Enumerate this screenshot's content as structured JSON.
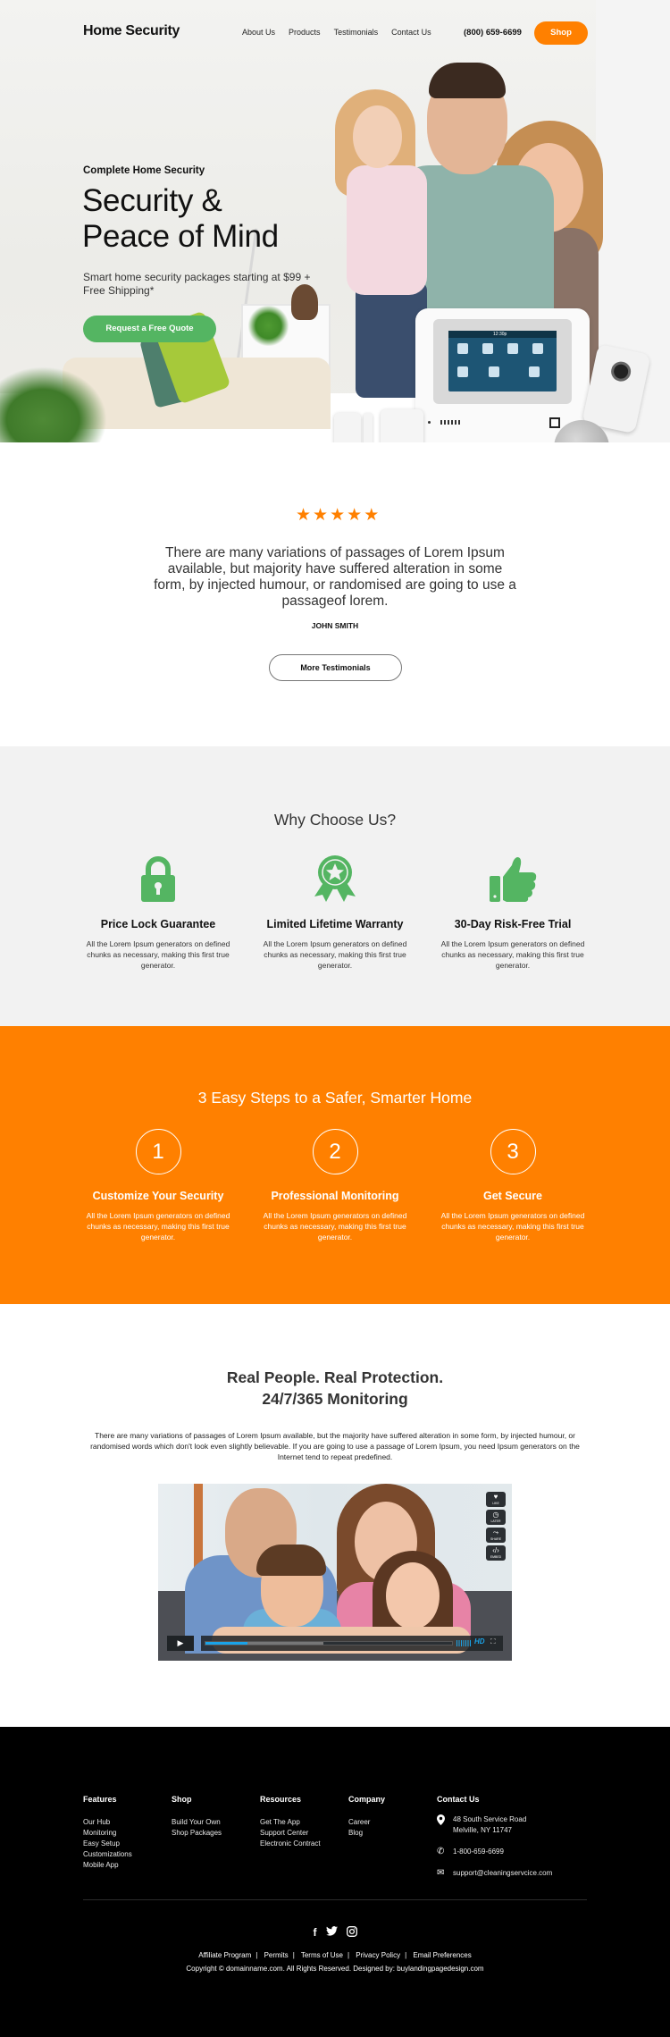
{
  "brand": {
    "name": "Home Security",
    "accent": "#ff8000",
    "green": "#54b562"
  },
  "nav": {
    "items": [
      {
        "label": "About Us"
      },
      {
        "label": "Products"
      },
      {
        "label": "Testimonials"
      },
      {
        "label": "Contact Us"
      }
    ],
    "phone": "(800) 659-6699",
    "shop_label": "Shop"
  },
  "hero": {
    "kicker": "Complete Home Security",
    "title_line1": "Security &",
    "title_line2": "Peace of Mind",
    "subtitle": "Smart home security packages starting at $99 + Free Shipping*",
    "cta_label": "Request a Free Quote",
    "device_screen_time": "12:30p"
  },
  "testimonial": {
    "rating": 5,
    "rating_max": 5,
    "quote": "There are many variations of passages of Lorem Ipsum available, but majority have suffered alteration in some form, by injected humour, or randomised are going to use a passageof lorem.",
    "author": "JOHN SMITH",
    "more_label": "More Testimonials"
  },
  "why": {
    "title": "Why Choose Us?",
    "features": [
      {
        "icon": "padlock-icon",
        "title": "Price Lock Guarantee",
        "text": "All the Lorem Ipsum generators on defined chunks as necessary, making this first true generator."
      },
      {
        "icon": "award-ribbon-icon",
        "title": "Limited Lifetime Warranty",
        "text": "All the Lorem Ipsum generators on defined chunks as necessary, making this first true generator."
      },
      {
        "icon": "thumbs-up-icon",
        "title": "30-Day Risk-Free Trial",
        "text": "All the Lorem Ipsum generators on defined chunks as necessary, making this first true generator."
      }
    ]
  },
  "steps": {
    "title": "3 Easy Steps to a Safer, Smarter Home",
    "items": [
      {
        "number": "1",
        "title": "Customize Your Security",
        "text": "All the Lorem Ipsum generators on defined chunks as necessary, making this first true generator."
      },
      {
        "number": "2",
        "title": "Professional Monitoring",
        "text": "All the Lorem Ipsum generators on defined chunks as necessary, making this first true generator."
      },
      {
        "number": "3",
        "title": "Get Secure",
        "text": "All the Lorem Ipsum generators on defined chunks as necessary, making this first true generator."
      }
    ]
  },
  "monitoring": {
    "title_line1": "Real People. Real Protection.",
    "title_line2": "24/7/365 Monitoring",
    "text": "There are many variations of passages of Lorem Ipsum available, but the majority have suffered alteration in some form, by injected humour, or randomised words which don't look even slightly believable. If you are going to use a passage of Lorem Ipsum, you need Ipsum generators on the Internet tend to repeat predefined.",
    "video": {
      "side_buttons": [
        {
          "icon": "heart-icon",
          "label": "LIKE"
        },
        {
          "icon": "clock-icon",
          "label": "LATER"
        },
        {
          "icon": "share-icon",
          "label": "SHARE"
        },
        {
          "icon": "embed-icon",
          "label": "EMBED"
        }
      ],
      "progress_fraction": 0.17,
      "buffered_fraction": 0.48,
      "quality_label": "HD"
    }
  },
  "footer": {
    "columns": [
      {
        "title": "Features",
        "links": [
          "Our Hub",
          "Monitoring",
          "Easy Setup",
          "Customizations",
          "Mobile App"
        ]
      },
      {
        "title": "Shop",
        "links": [
          "Build Your Own",
          "Shop Packages"
        ]
      },
      {
        "title": "Resources",
        "links": [
          "Get The App",
          "Support Center",
          "Electronic Contract"
        ]
      },
      {
        "title": "Company",
        "links": [
          "Career",
          "Blog"
        ]
      }
    ],
    "contact": {
      "title": "Contact Us",
      "address_line1": "48 South Service Road",
      "address_line2": "Melville, NY 11747",
      "phone": "1-800-659-6699",
      "email": "support@cleaningservcice.com"
    },
    "social": [
      "facebook-icon",
      "twitter-icon",
      "instagram-icon"
    ],
    "legal_links": [
      "Affiliate Program",
      "Permits",
      "Terms of Use",
      "Privacy Policy",
      "Email Preferences"
    ],
    "copyright": "Copyright © domainname.com. All Rights Reserved. Designed by: buylandingpagedesign.com"
  }
}
